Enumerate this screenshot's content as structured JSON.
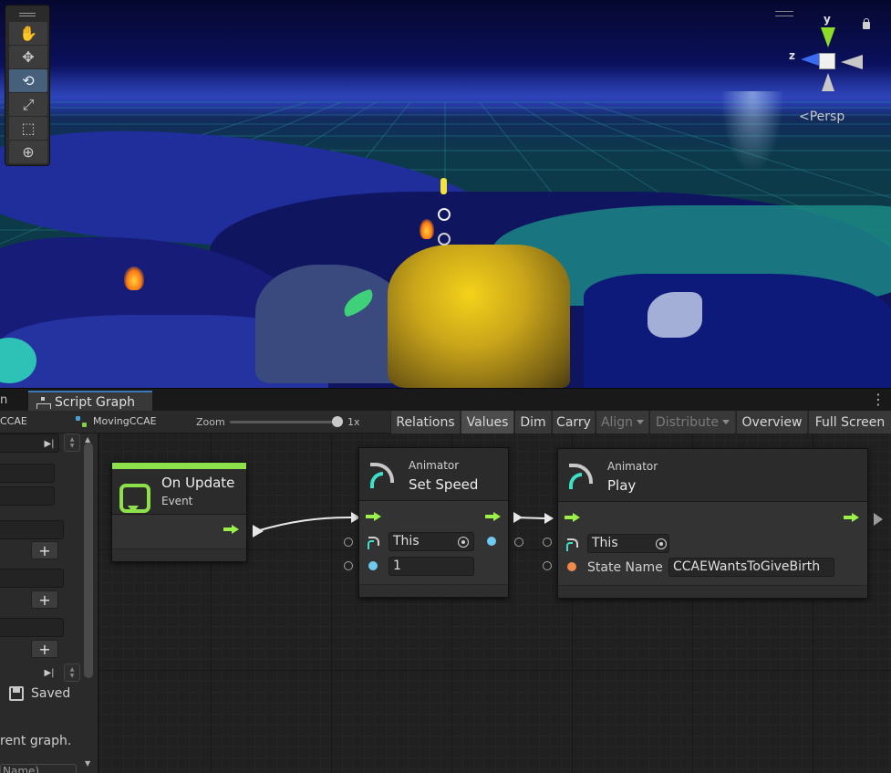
{
  "scene": {
    "tools": [
      {
        "name": "hand-tool",
        "glyph": "✋",
        "active": false
      },
      {
        "name": "move-tool",
        "glyph": "✥",
        "active": false
      },
      {
        "name": "rotate-tool",
        "glyph": "⟲",
        "active": true
      },
      {
        "name": "scale-tool",
        "glyph": "⤢",
        "active": false
      },
      {
        "name": "rect-tool",
        "glyph": "⬚",
        "active": false
      },
      {
        "name": "transform-tool",
        "glyph": "⊕",
        "active": false
      }
    ],
    "gizmo": {
      "y_label": "y",
      "z_label": "z",
      "projection": "<Persp"
    }
  },
  "window": {
    "tab_cut": "n",
    "tab_label": "Script Graph",
    "menu_glyph": "⋮"
  },
  "toolbar": {
    "crumb_cut": "CCAE",
    "graph_name": "MovingCCAE",
    "zoom_label": "Zoom",
    "zoom_value": "1x",
    "zoom_level": 1.0,
    "buttons": [
      {
        "id": "relations",
        "label": "Relations",
        "state": "normal"
      },
      {
        "id": "values",
        "label": "Values",
        "state": "on"
      },
      {
        "id": "dim",
        "label": "Dim",
        "state": "normal"
      },
      {
        "id": "carry",
        "label": "Carry",
        "state": "normal"
      },
      {
        "id": "align",
        "label": "Align",
        "state": "disabled",
        "dropdown": true
      },
      {
        "id": "distribute",
        "label": "Distribute",
        "state": "disabled",
        "dropdown": true
      },
      {
        "id": "overview",
        "label": "Overview",
        "state": "normal"
      },
      {
        "id": "fullscreen",
        "label": "Full Screen",
        "state": "normal"
      }
    ]
  },
  "sidebar": {
    "saved_label": "Saved",
    "hint_text": "rent graph.",
    "last_field": "Name)"
  },
  "nodes": {
    "on_update": {
      "title": "On Update",
      "subtitle": "Event"
    },
    "set_speed": {
      "subtitle": "Animator",
      "title": "Set Speed",
      "target": "This",
      "value": "1"
    },
    "play": {
      "subtitle": "Animator",
      "title": "Play",
      "target": "This",
      "state_label": "State Name",
      "state_value": "CCAEWantsToGiveBirth"
    }
  },
  "colors": {
    "flow": "#9bf04a",
    "value_port": "#6fcaf0",
    "string_port": "#f2884a",
    "accent_tab": "#3a79bb"
  }
}
